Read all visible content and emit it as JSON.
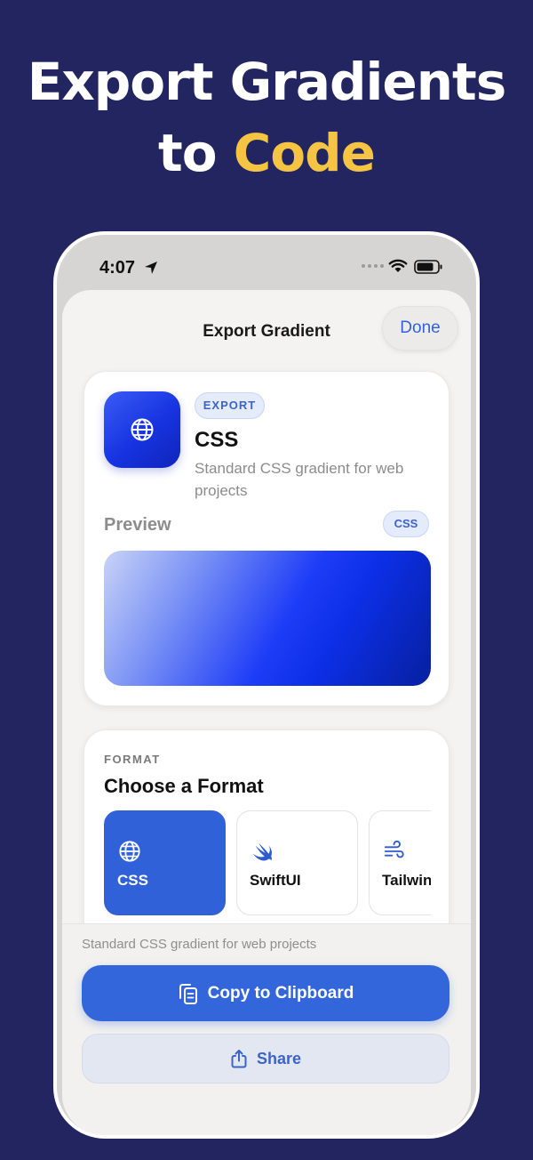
{
  "headline": {
    "line1": "Export Gradients",
    "line2_plain": "to ",
    "line2_accent": "Code"
  },
  "status_bar": {
    "time": "4:07"
  },
  "sheet": {
    "title": "Export Gradient",
    "done_label": "Done"
  },
  "export_card": {
    "badge": "EXPORT",
    "title": "CSS",
    "description": "Standard CSS gradient for web projects",
    "preview_label": "Preview",
    "preview_badge": "CSS"
  },
  "format_card": {
    "section_label": "FORMAT",
    "title": "Choose a Format",
    "options": [
      {
        "label": "CSS",
        "icon": "globe-icon",
        "selected": true
      },
      {
        "label": "SwiftUI",
        "icon": "swift-icon",
        "selected": false
      },
      {
        "label": "Tailwin",
        "icon": "wind-icon",
        "selected": false
      }
    ]
  },
  "bottom": {
    "description": "Standard CSS gradient for web projects",
    "copy_label": "Copy to Clipboard",
    "share_label": "Share"
  },
  "colors": {
    "background": "#22255f",
    "accent": "#f6c443",
    "primary": "#3366db"
  }
}
